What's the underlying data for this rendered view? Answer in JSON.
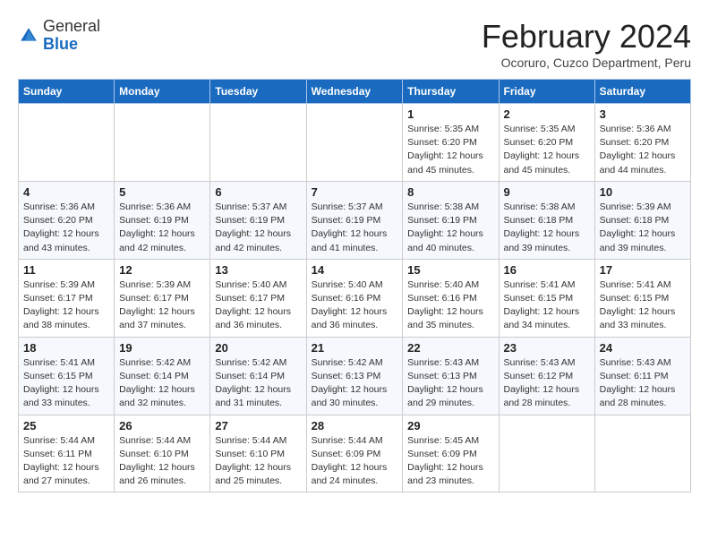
{
  "logo": {
    "general": "General",
    "blue": "Blue"
  },
  "header": {
    "month": "February 2024",
    "location": "Ocoruro, Cuzco Department, Peru"
  },
  "weekdays": [
    "Sunday",
    "Monday",
    "Tuesday",
    "Wednesday",
    "Thursday",
    "Friday",
    "Saturday"
  ],
  "weeks": [
    [
      {
        "day": "",
        "info": ""
      },
      {
        "day": "",
        "info": ""
      },
      {
        "day": "",
        "info": ""
      },
      {
        "day": "",
        "info": ""
      },
      {
        "day": "1",
        "info": "Sunrise: 5:35 AM\nSunset: 6:20 PM\nDaylight: 12 hours\nand 45 minutes."
      },
      {
        "day": "2",
        "info": "Sunrise: 5:35 AM\nSunset: 6:20 PM\nDaylight: 12 hours\nand 45 minutes."
      },
      {
        "day": "3",
        "info": "Sunrise: 5:36 AM\nSunset: 6:20 PM\nDaylight: 12 hours\nand 44 minutes."
      }
    ],
    [
      {
        "day": "4",
        "info": "Sunrise: 5:36 AM\nSunset: 6:20 PM\nDaylight: 12 hours\nand 43 minutes."
      },
      {
        "day": "5",
        "info": "Sunrise: 5:36 AM\nSunset: 6:19 PM\nDaylight: 12 hours\nand 42 minutes."
      },
      {
        "day": "6",
        "info": "Sunrise: 5:37 AM\nSunset: 6:19 PM\nDaylight: 12 hours\nand 42 minutes."
      },
      {
        "day": "7",
        "info": "Sunrise: 5:37 AM\nSunset: 6:19 PM\nDaylight: 12 hours\nand 41 minutes."
      },
      {
        "day": "8",
        "info": "Sunrise: 5:38 AM\nSunset: 6:19 PM\nDaylight: 12 hours\nand 40 minutes."
      },
      {
        "day": "9",
        "info": "Sunrise: 5:38 AM\nSunset: 6:18 PM\nDaylight: 12 hours\nand 39 minutes."
      },
      {
        "day": "10",
        "info": "Sunrise: 5:39 AM\nSunset: 6:18 PM\nDaylight: 12 hours\nand 39 minutes."
      }
    ],
    [
      {
        "day": "11",
        "info": "Sunrise: 5:39 AM\nSunset: 6:17 PM\nDaylight: 12 hours\nand 38 minutes."
      },
      {
        "day": "12",
        "info": "Sunrise: 5:39 AM\nSunset: 6:17 PM\nDaylight: 12 hours\nand 37 minutes."
      },
      {
        "day": "13",
        "info": "Sunrise: 5:40 AM\nSunset: 6:17 PM\nDaylight: 12 hours\nand 36 minutes."
      },
      {
        "day": "14",
        "info": "Sunrise: 5:40 AM\nSunset: 6:16 PM\nDaylight: 12 hours\nand 36 minutes."
      },
      {
        "day": "15",
        "info": "Sunrise: 5:40 AM\nSunset: 6:16 PM\nDaylight: 12 hours\nand 35 minutes."
      },
      {
        "day": "16",
        "info": "Sunrise: 5:41 AM\nSunset: 6:15 PM\nDaylight: 12 hours\nand 34 minutes."
      },
      {
        "day": "17",
        "info": "Sunrise: 5:41 AM\nSunset: 6:15 PM\nDaylight: 12 hours\nand 33 minutes."
      }
    ],
    [
      {
        "day": "18",
        "info": "Sunrise: 5:41 AM\nSunset: 6:15 PM\nDaylight: 12 hours\nand 33 minutes."
      },
      {
        "day": "19",
        "info": "Sunrise: 5:42 AM\nSunset: 6:14 PM\nDaylight: 12 hours\nand 32 minutes."
      },
      {
        "day": "20",
        "info": "Sunrise: 5:42 AM\nSunset: 6:14 PM\nDaylight: 12 hours\nand 31 minutes."
      },
      {
        "day": "21",
        "info": "Sunrise: 5:42 AM\nSunset: 6:13 PM\nDaylight: 12 hours\nand 30 minutes."
      },
      {
        "day": "22",
        "info": "Sunrise: 5:43 AM\nSunset: 6:13 PM\nDaylight: 12 hours\nand 29 minutes."
      },
      {
        "day": "23",
        "info": "Sunrise: 5:43 AM\nSunset: 6:12 PM\nDaylight: 12 hours\nand 28 minutes."
      },
      {
        "day": "24",
        "info": "Sunrise: 5:43 AM\nSunset: 6:11 PM\nDaylight: 12 hours\nand 28 minutes."
      }
    ],
    [
      {
        "day": "25",
        "info": "Sunrise: 5:44 AM\nSunset: 6:11 PM\nDaylight: 12 hours\nand 27 minutes."
      },
      {
        "day": "26",
        "info": "Sunrise: 5:44 AM\nSunset: 6:10 PM\nDaylight: 12 hours\nand 26 minutes."
      },
      {
        "day": "27",
        "info": "Sunrise: 5:44 AM\nSunset: 6:10 PM\nDaylight: 12 hours\nand 25 minutes."
      },
      {
        "day": "28",
        "info": "Sunrise: 5:44 AM\nSunset: 6:09 PM\nDaylight: 12 hours\nand 24 minutes."
      },
      {
        "day": "29",
        "info": "Sunrise: 5:45 AM\nSunset: 6:09 PM\nDaylight: 12 hours\nand 23 minutes."
      },
      {
        "day": "",
        "info": ""
      },
      {
        "day": "",
        "info": ""
      }
    ]
  ]
}
